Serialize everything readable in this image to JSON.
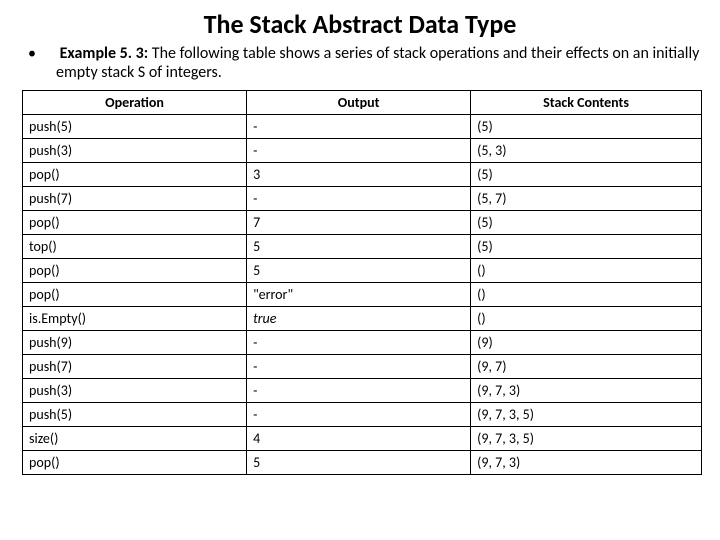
{
  "title": "The Stack Abstract Data Type",
  "example": {
    "bullet": "•",
    "label": "Example 5. 3:",
    "text": "The following table shows a series of stack operations and their effects on an initially empty stack S of integers."
  },
  "table": {
    "headers": [
      "Operation",
      "Output",
      "Stack Contents"
    ],
    "rows": [
      {
        "op": "push(5)",
        "out": "-",
        "stack": "(5)"
      },
      {
        "op": "push(3)",
        "out": "-",
        "stack": "(5, 3)"
      },
      {
        "op": "pop()",
        "out": "3",
        "stack": "(5)"
      },
      {
        "op": "push(7)",
        "out": "-",
        "stack": "(5, 7)"
      },
      {
        "op": "pop()",
        "out": "7",
        "stack": "(5)"
      },
      {
        "op": "top()",
        "out": "5",
        "stack": "(5)"
      },
      {
        "op": "pop()",
        "out": "5",
        "stack": "()"
      },
      {
        "op": "pop()",
        "out": "\"error\"",
        "stack": "()"
      },
      {
        "op": "is.Empty()",
        "out": "true",
        "stack": "()",
        "outItalic": true
      },
      {
        "op": "push(9)",
        "out": "-",
        "stack": "(9)"
      },
      {
        "op": "push(7)",
        "out": "-",
        "stack": "(9, 7)"
      },
      {
        "op": "push(3)",
        "out": "-",
        "stack": "(9, 7, 3)"
      },
      {
        "op": "push(5)",
        "out": "-",
        "stack": "(9, 7, 3, 5)"
      },
      {
        "op": "size()",
        "out": "4",
        "stack": "(9, 7, 3, 5)"
      },
      {
        "op": "pop()",
        "out": "5",
        "stack": "(9, 7, 3)"
      }
    ]
  }
}
